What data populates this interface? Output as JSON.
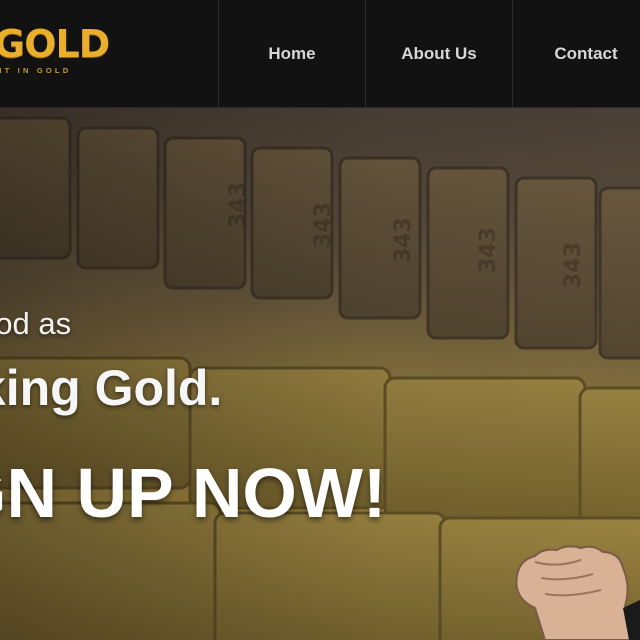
{
  "brand": {
    "logo_text": "GOLD",
    "tagline": "HT IN GOLD",
    "accent": "#e8ae2c"
  },
  "nav": {
    "items": [
      {
        "label": "Home"
      },
      {
        "label": "About Us"
      },
      {
        "label": "Contact"
      }
    ]
  },
  "hero": {
    "line1": "ood as",
    "line2": "iking Gold.",
    "line3": "GN UP NOW!",
    "bar_stamp": "343"
  }
}
